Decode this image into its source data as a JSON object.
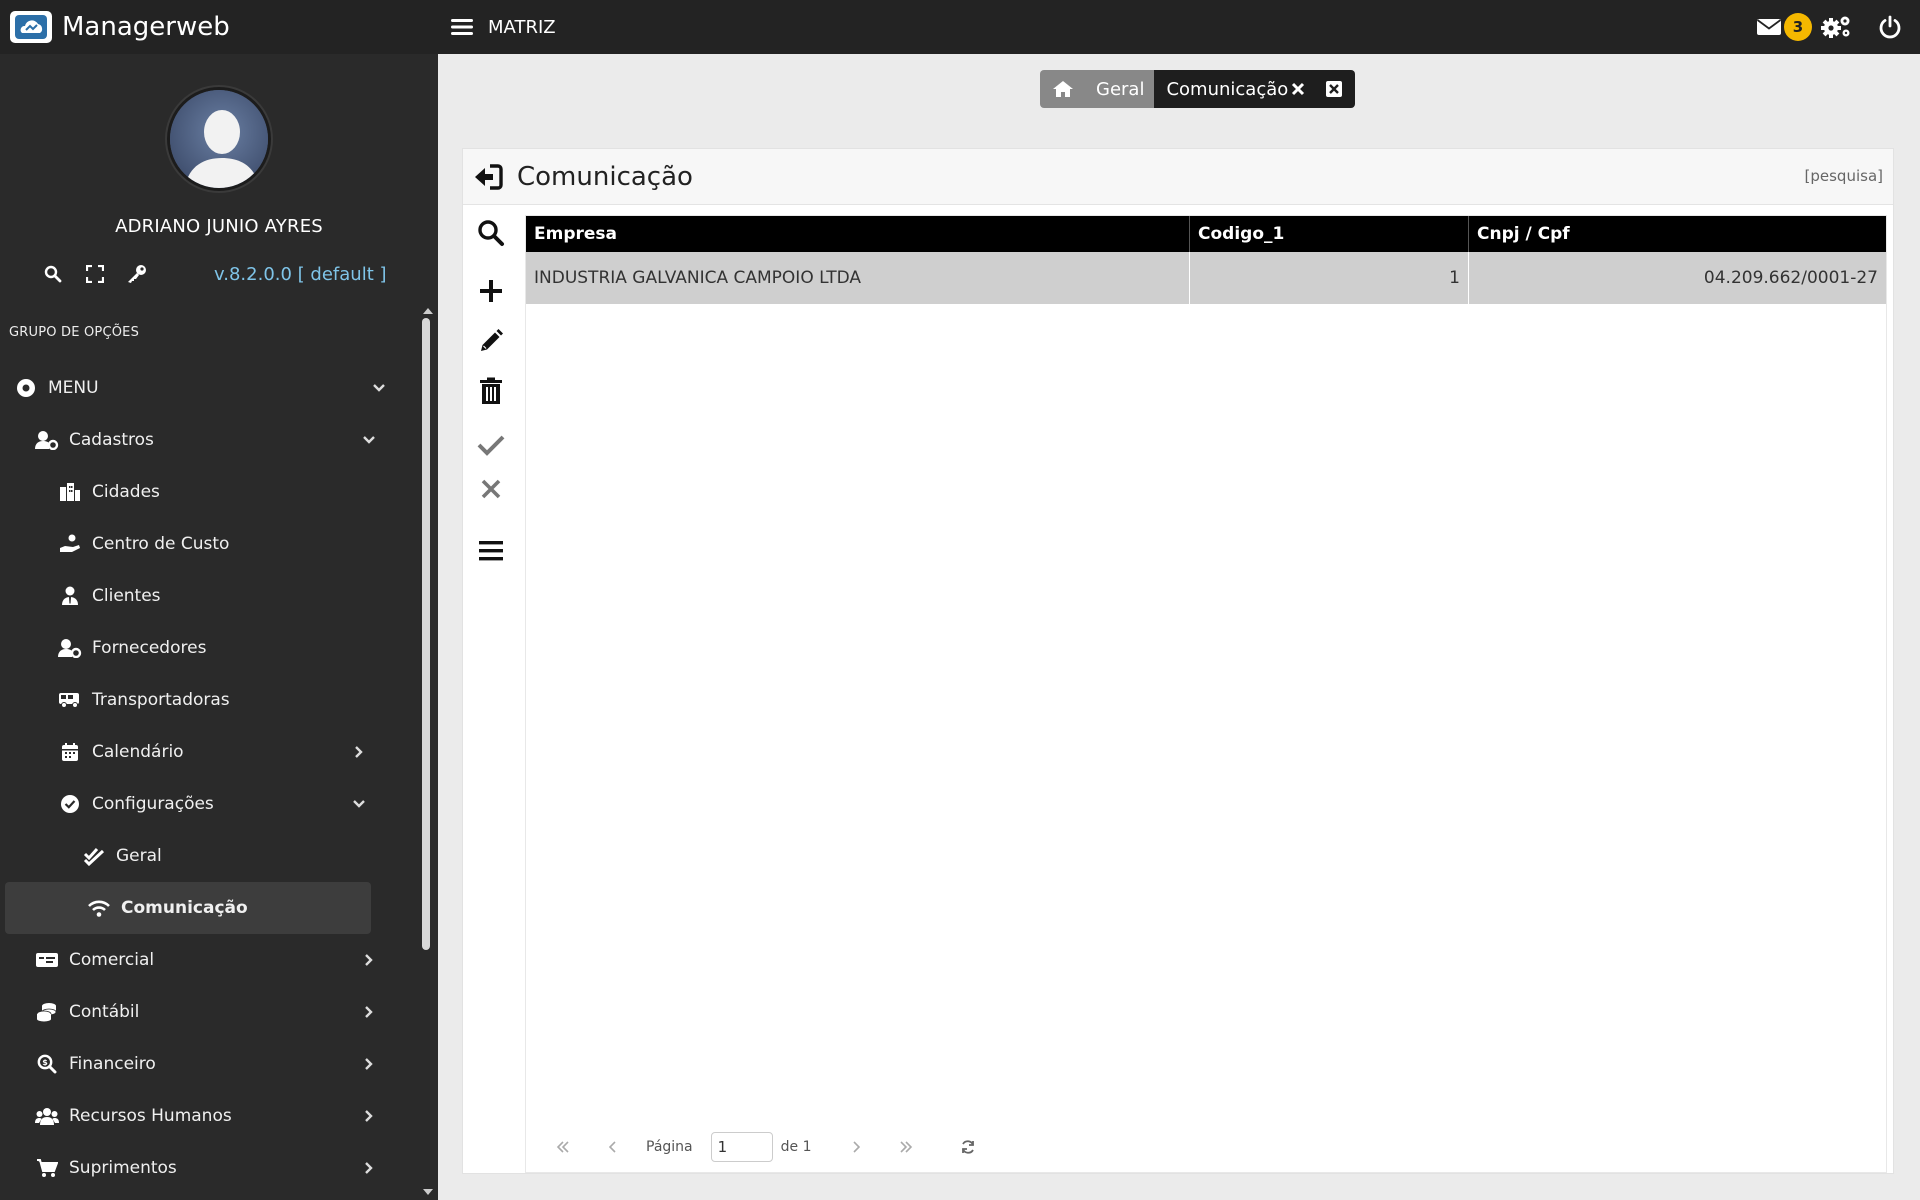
{
  "app": {
    "name": "Managerweb",
    "company": "MATRIZ"
  },
  "user": {
    "name": "ADRIANO JUNIO AYRES",
    "version": "v.8.2.0.0 [ default ]"
  },
  "sidebar": {
    "group_label": "GRUPO DE OPÇÕES",
    "menu_label": "MENU",
    "cadastros_label": "Cadastros",
    "items": {
      "cidades": "Cidades",
      "centro_custo": "Centro de Custo",
      "clientes": "Clientes",
      "fornecedores": "Fornecedores",
      "transportadoras": "Transportadoras",
      "calendario": "Calendário",
      "configuracoes": "Configurações",
      "geral": "Geral",
      "comunicacao": "Comunicação",
      "comercial": "Comercial",
      "contabil": "Contábil",
      "financeiro": "Financeiro",
      "rh": "Recursos Humanos",
      "suprimentos": "Suprimentos"
    }
  },
  "topbar": {
    "notification_count": "3"
  },
  "breadcrumb": {
    "geral": "Geral",
    "active": "Comunicação"
  },
  "panel": {
    "title": "Comunicação",
    "search_link": "[pesquisa]"
  },
  "table": {
    "columns": [
      "Empresa",
      "Codigo_1",
      "Cnpj / Cpf"
    ],
    "rows": [
      [
        "INDUSTRIA GALVANICA CAMPOIO LTDA",
        "1",
        "04.209.662/0001-27"
      ]
    ]
  },
  "pager": {
    "page_label": "Página",
    "page_value": "1",
    "of_label": "de 1"
  },
  "colors": {
    "sidebar_bg": "#2a2a2a",
    "topbar_bg": "#232323",
    "version": "#7fc4e8",
    "badge": "#f5b800",
    "selected_row": "#cfcfcf"
  }
}
